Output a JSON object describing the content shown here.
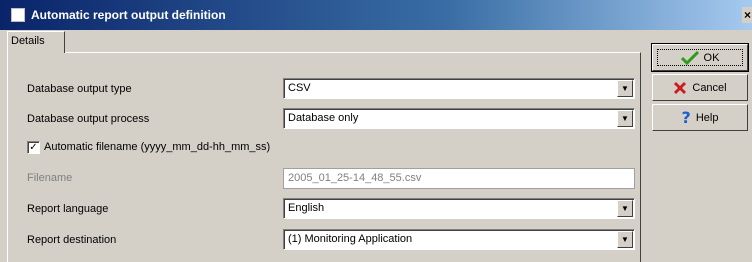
{
  "window": {
    "title": "Automatic report output definition",
    "close": "×"
  },
  "tabs": [
    {
      "label": "Details"
    }
  ],
  "form": {
    "db_output_type": {
      "label": "Database output type",
      "value": "CSV"
    },
    "db_output_process": {
      "label": "Database output process",
      "value": "Database only"
    },
    "auto_filename": {
      "label": "Automatic filename (yyyy_mm_dd-hh_mm_ss)",
      "checked": true
    },
    "filename": {
      "label": "Filename",
      "value": "2005_01_25-14_48_55.csv"
    },
    "report_language": {
      "label": "Report language",
      "value": "English"
    },
    "report_destination": {
      "label": "Report destination",
      "value": "(1)  Monitoring Application"
    }
  },
  "buttons": {
    "ok": "OK",
    "cancel": "Cancel",
    "help": "Help"
  },
  "colors": {
    "title_gradient_start": "#0a246a",
    "title_gradient_end": "#a6caf0",
    "ok_check": "#2e9a1e",
    "cancel_x": "#c81e1e",
    "help_q": "#1a5fd0"
  }
}
